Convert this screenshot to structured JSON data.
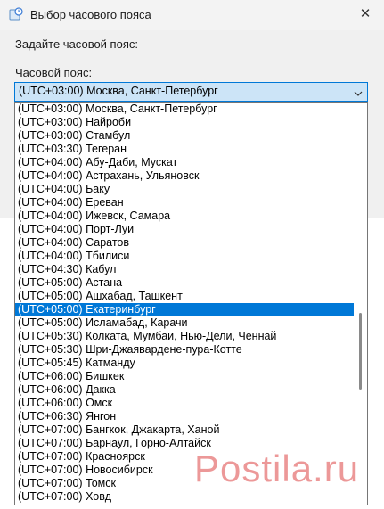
{
  "window": {
    "title": "Выбор часового пояса",
    "icon": "clock-globe-icon",
    "close_symbol": "✕"
  },
  "dialog": {
    "prompt": "Задайте часовой пояс:",
    "timezone_label": "Часовой пояс:"
  },
  "combo": {
    "value": "(UTC+03:00) Москва, Санкт-Петербург",
    "arrow_icon": "chevron-down-icon"
  },
  "dropdown": {
    "selected_index": 15,
    "items": [
      "(UTC+03:00) Москва, Санкт-Петербург",
      "(UTC+03:00) Найроби",
      "(UTC+03:00) Стамбул",
      "(UTC+03:30) Тегеран",
      "(UTC+04:00) Абу-Даби, Мускат",
      "(UTC+04:00) Астрахань, Ульяновск",
      "(UTC+04:00) Баку",
      "(UTC+04:00) Ереван",
      "(UTC+04:00) Ижевск, Самара",
      "(UTC+04:00) Порт-Луи",
      "(UTC+04:00) Саратов",
      "(UTC+04:00) Тбилиси",
      "(UTC+04:30) Кабул",
      "(UTC+05:00) Астана",
      "(UTC+05:00) Ашхабад, Ташкент",
      "(UTC+05:00) Екатеринбург",
      "(UTC+05:00) Исламабад, Карачи",
      "(UTC+05:30) Колката, Мумбаи, Нью-Дели, Ченнай",
      "(UTC+05:30) Шри-Джаявардене-пура-Котте",
      "(UTC+05:45) Катманду",
      "(UTC+06:00) Бишкек",
      "(UTC+06:00) Дакка",
      "(UTC+06:00) Омск",
      "(UTC+06:30) Янгон",
      "(UTC+07:00) Бангкок, Джакарта, Ханой",
      "(UTC+07:00) Барнаул, Горно-Алтайск",
      "(UTC+07:00) Красноярск",
      "(UTC+07:00) Новосибирск",
      "(UTC+07:00) Томск",
      "(UTC+07:00) Ховд"
    ]
  },
  "watermark": {
    "text": "Postila.ru"
  },
  "colors": {
    "accent": "#0078d7",
    "combo_bg": "#cce4f7",
    "dialog_bg": "#f0f0f0",
    "watermark": "#dd4444"
  }
}
